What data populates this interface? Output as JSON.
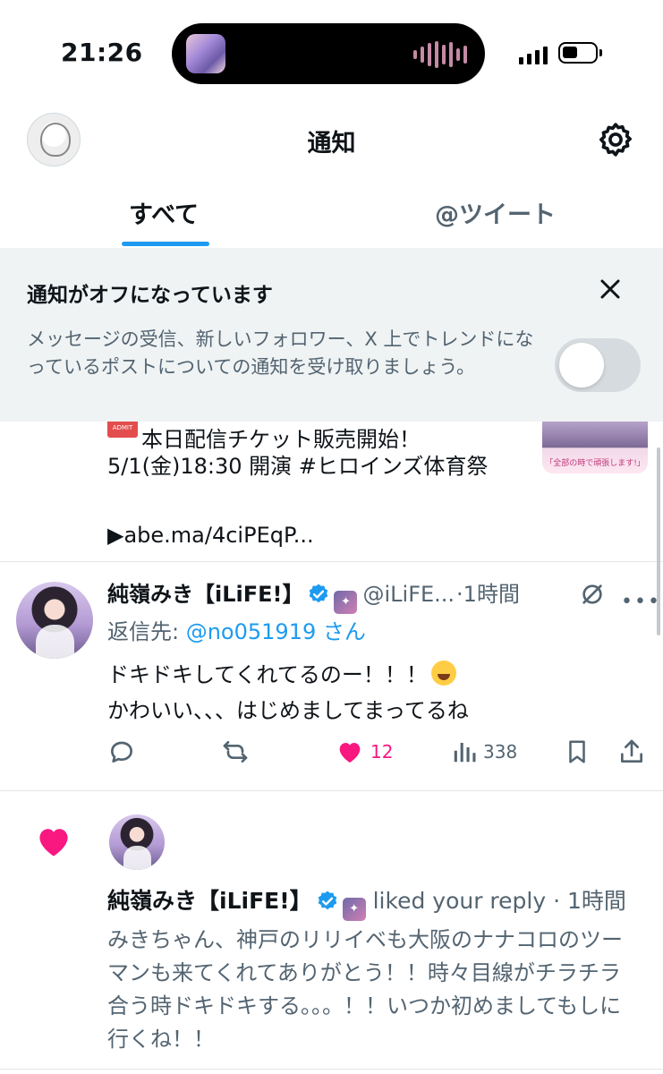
{
  "status_bar": {
    "time": "21:26",
    "signal": "signal-icon",
    "battery": "battery-icon"
  },
  "header": {
    "title": "通知",
    "settings_icon": "gear-icon"
  },
  "tabs": [
    {
      "label": "すべて",
      "selected": true
    },
    {
      "label": "@ツイート",
      "selected": false
    }
  ],
  "banner": {
    "title": "通知がオフになっています",
    "text": "メッセージの受信、新しいフォロワー、X 上でトレンドになっているポストについての通知を受け取りましょう。",
    "toggle_on": false
  },
  "previous_post": {
    "line1": "本日配信チケット販売開始！",
    "line2": "5/1(金)18:30 開演 #ヒロインズ体育祭",
    "line3": "▶abe.ma/4ciPEqP...",
    "ticket_emoji_text": "ADMIT ONE",
    "thumbnail_caption": "「全部の時で頑張します!」"
  },
  "post": {
    "author_name": "純嶺みき【iLiFE!】",
    "label_badge_text": "iLiFE!",
    "handle": "@iLiFE...",
    "time": "·1時間",
    "reply_prefix": "返信先: ",
    "reply_mention": "@no051919 さん",
    "body_line1": "ドキドキしてくれてるのー！！！",
    "body_line2": "かわいい、、、はじめましてまってるね",
    "likes": "12",
    "views": "338",
    "liked": true
  },
  "like_notification": {
    "author_name": "純嶺みき【iLiFE!】",
    "label_badge_text": "iLiFE!",
    "action": "liked your reply",
    "time": "· 1時間",
    "text": "みきちゃん、神戸のリリイベも大阪のナナコロのツーマンも来てくれてありがとう！！時々目線がチラチラ合う時ドキドキする。。。！！いつか初めましてもしに行くね！！"
  },
  "colors": {
    "accent": "#1d9bf0",
    "like": "#f91880",
    "muted": "#536471",
    "banner_bg": "#eff3f4"
  }
}
